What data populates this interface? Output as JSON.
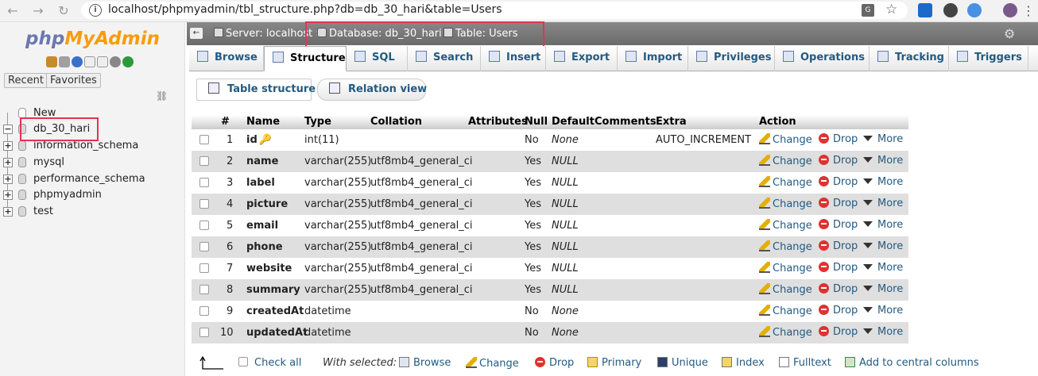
{
  "browser": {
    "back_icon": "arrow-left",
    "forward_icon": "arrow-right",
    "reload_icon": "reload",
    "url_text": "localhost/phpmyadmin/tbl_structure.php?db=db_30_hari&table=Users"
  },
  "sidebar": {
    "logo_php": "php",
    "logo_myadmin": "MyAdmin",
    "recent_label": "Recent",
    "favorites_label": "Favorites",
    "tree": [
      {
        "label": "New",
        "expander": ""
      },
      {
        "label": "db_30_hari",
        "expander": "−"
      },
      {
        "label": "information_schema",
        "expander": "+"
      },
      {
        "label": "mysql",
        "expander": "+"
      },
      {
        "label": "performance_schema",
        "expander": "+"
      },
      {
        "label": "phpmyadmin",
        "expander": "+"
      },
      {
        "label": "test",
        "expander": "+"
      }
    ]
  },
  "breadcrumb": {
    "server": "Server: localhost",
    "sep1": "»",
    "database": "Database: db_30_hari",
    "sep2": "»",
    "table": "Table: Users"
  },
  "tabs": [
    {
      "label": "Browse",
      "active": false
    },
    {
      "label": "Structure",
      "active": true
    },
    {
      "label": "SQL",
      "active": false
    },
    {
      "label": "Search",
      "active": false
    },
    {
      "label": "Insert",
      "active": false
    },
    {
      "label": "Export",
      "active": false
    },
    {
      "label": "Import",
      "active": false
    },
    {
      "label": "Privileges",
      "active": false
    },
    {
      "label": "Operations",
      "active": false
    },
    {
      "label": "Tracking",
      "active": false
    },
    {
      "label": "Triggers",
      "active": false
    }
  ],
  "subtabs": {
    "table_structure": "Table structure",
    "relation_view": "Relation view"
  },
  "table": {
    "headers": {
      "num": "#",
      "name": "Name",
      "type": "Type",
      "collation": "Collation",
      "attributes": "Attributes",
      "null": "Null",
      "default": "Default",
      "comments": "Comments",
      "extra": "Extra",
      "action": "Action"
    },
    "rows": [
      {
        "num": "1",
        "name": "id",
        "type": "int(11)",
        "collation": "",
        "null": "No",
        "default": "None",
        "extra": "AUTO_INCREMENT",
        "primary_key": true
      },
      {
        "num": "2",
        "name": "name",
        "type": "varchar(255)",
        "collation": "utf8mb4_general_ci",
        "null": "Yes",
        "default": "NULL",
        "extra": ""
      },
      {
        "num": "3",
        "name": "label",
        "type": "varchar(255)",
        "collation": "utf8mb4_general_ci",
        "null": "Yes",
        "default": "NULL",
        "extra": ""
      },
      {
        "num": "4",
        "name": "picture",
        "type": "varchar(255)",
        "collation": "utf8mb4_general_ci",
        "null": "Yes",
        "default": "NULL",
        "extra": ""
      },
      {
        "num": "5",
        "name": "email",
        "type": "varchar(255)",
        "collation": "utf8mb4_general_ci",
        "null": "Yes",
        "default": "NULL",
        "extra": ""
      },
      {
        "num": "6",
        "name": "phone",
        "type": "varchar(255)",
        "collation": "utf8mb4_general_ci",
        "null": "Yes",
        "default": "NULL",
        "extra": ""
      },
      {
        "num": "7",
        "name": "website",
        "type": "varchar(255)",
        "collation": "utf8mb4_general_ci",
        "null": "Yes",
        "default": "NULL",
        "extra": ""
      },
      {
        "num": "8",
        "name": "summary",
        "type": "varchar(255)",
        "collation": "utf8mb4_general_ci",
        "null": "Yes",
        "default": "NULL",
        "extra": ""
      },
      {
        "num": "9",
        "name": "createdAt",
        "type": "datetime",
        "collation": "",
        "null": "No",
        "default": "None",
        "extra": ""
      },
      {
        "num": "10",
        "name": "updatedAt",
        "type": "datetime",
        "collation": "",
        "null": "No",
        "default": "None",
        "extra": ""
      }
    ],
    "actions": {
      "change": "Change",
      "drop": "Drop",
      "more": "More"
    }
  },
  "footer": {
    "check_all": "Check all",
    "with_selected": "With selected:",
    "browse": "Browse",
    "change": "Change",
    "drop": "Drop",
    "primary": "Primary",
    "unique": "Unique",
    "index": "Index",
    "fulltext": "Fulltext",
    "add_central": "Add to central columns"
  },
  "colors": {
    "link": "#235a81",
    "highlight": "#e8324f",
    "row_alt": "#dfdfdf"
  }
}
